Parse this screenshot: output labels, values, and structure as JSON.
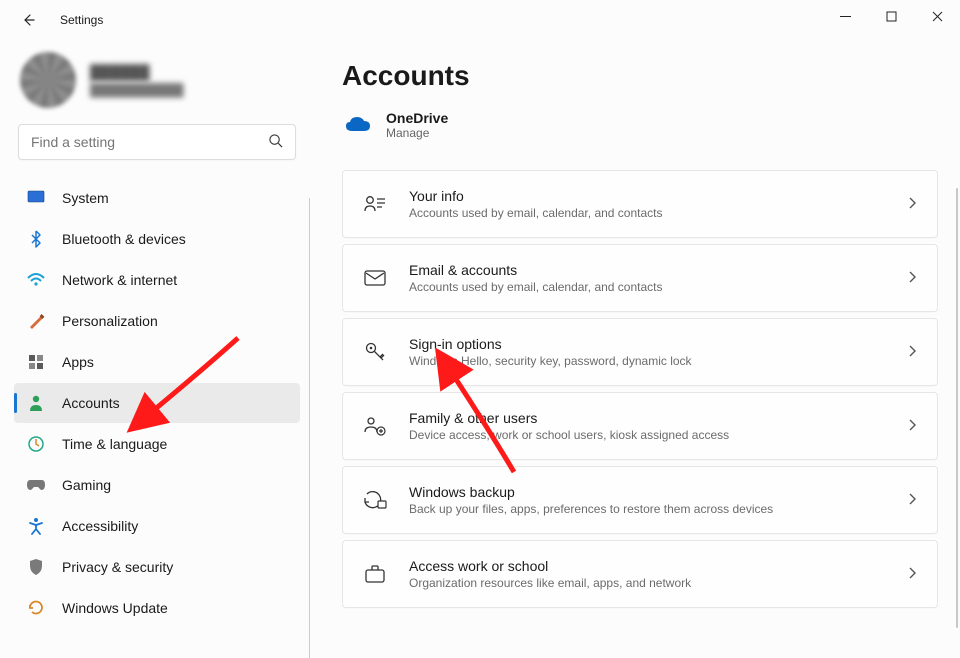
{
  "window": {
    "title": "Settings"
  },
  "profile": {
    "name_masked": "██████",
    "email_masked": "███████████"
  },
  "search": {
    "placeholder": "Find a setting"
  },
  "sidebar": {
    "items": [
      {
        "id": "system",
        "label": "System",
        "active": false
      },
      {
        "id": "bluetooth",
        "label": "Bluetooth & devices",
        "active": false
      },
      {
        "id": "network",
        "label": "Network & internet",
        "active": false
      },
      {
        "id": "personalization",
        "label": "Personalization",
        "active": false
      },
      {
        "id": "apps",
        "label": "Apps",
        "active": false
      },
      {
        "id": "accounts",
        "label": "Accounts",
        "active": true
      },
      {
        "id": "time",
        "label": "Time & language",
        "active": false
      },
      {
        "id": "gaming",
        "label": "Gaming",
        "active": false
      },
      {
        "id": "accessibility",
        "label": "Accessibility",
        "active": false
      },
      {
        "id": "privacy",
        "label": "Privacy & security",
        "active": false
      },
      {
        "id": "update",
        "label": "Windows Update",
        "active": false
      }
    ]
  },
  "main": {
    "heading": "Accounts",
    "onedrive": {
      "title": "OneDrive",
      "sub": "Manage"
    },
    "cards": [
      {
        "id": "your-info",
        "title": "Your info",
        "sub": "Accounts used by email, calendar, and contacts"
      },
      {
        "id": "email-accounts",
        "title": "Email & accounts",
        "sub": "Accounts used by email, calendar, and contacts"
      },
      {
        "id": "sign-in-options",
        "title": "Sign-in options",
        "sub": "Windows Hello, security key, password, dynamic lock"
      },
      {
        "id": "family",
        "title": "Family & other users",
        "sub": "Device access, work or school users, kiosk assigned access"
      },
      {
        "id": "backup",
        "title": "Windows backup",
        "sub": "Back up your files, apps, preferences to restore them across devices"
      },
      {
        "id": "work-school",
        "title": "Access work or school",
        "sub": "Organization resources like email, apps, and network"
      }
    ]
  },
  "colors": {
    "accent": "#1976d2",
    "cloud": "#0a68c4",
    "arrow": "#ff1a1a"
  }
}
